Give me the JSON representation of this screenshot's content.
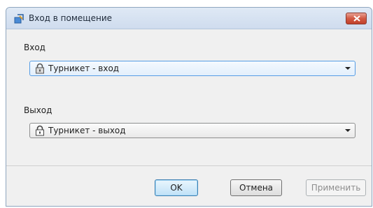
{
  "window": {
    "title": "Вход в помещение",
    "icon": "door-access-icon"
  },
  "entry": {
    "label": "Вход",
    "selected": "Турникет - вход",
    "icon": "padlock-icon"
  },
  "exit": {
    "label": "Выход",
    "selected": "Турникет - выход",
    "icon": "padlock-icon"
  },
  "buttons": {
    "ok": "OK",
    "cancel": "Отмена",
    "apply": "Применить"
  },
  "colors": {
    "titlebar": "#cfdcee",
    "close": "#c1402a",
    "focus": "#569de5"
  }
}
